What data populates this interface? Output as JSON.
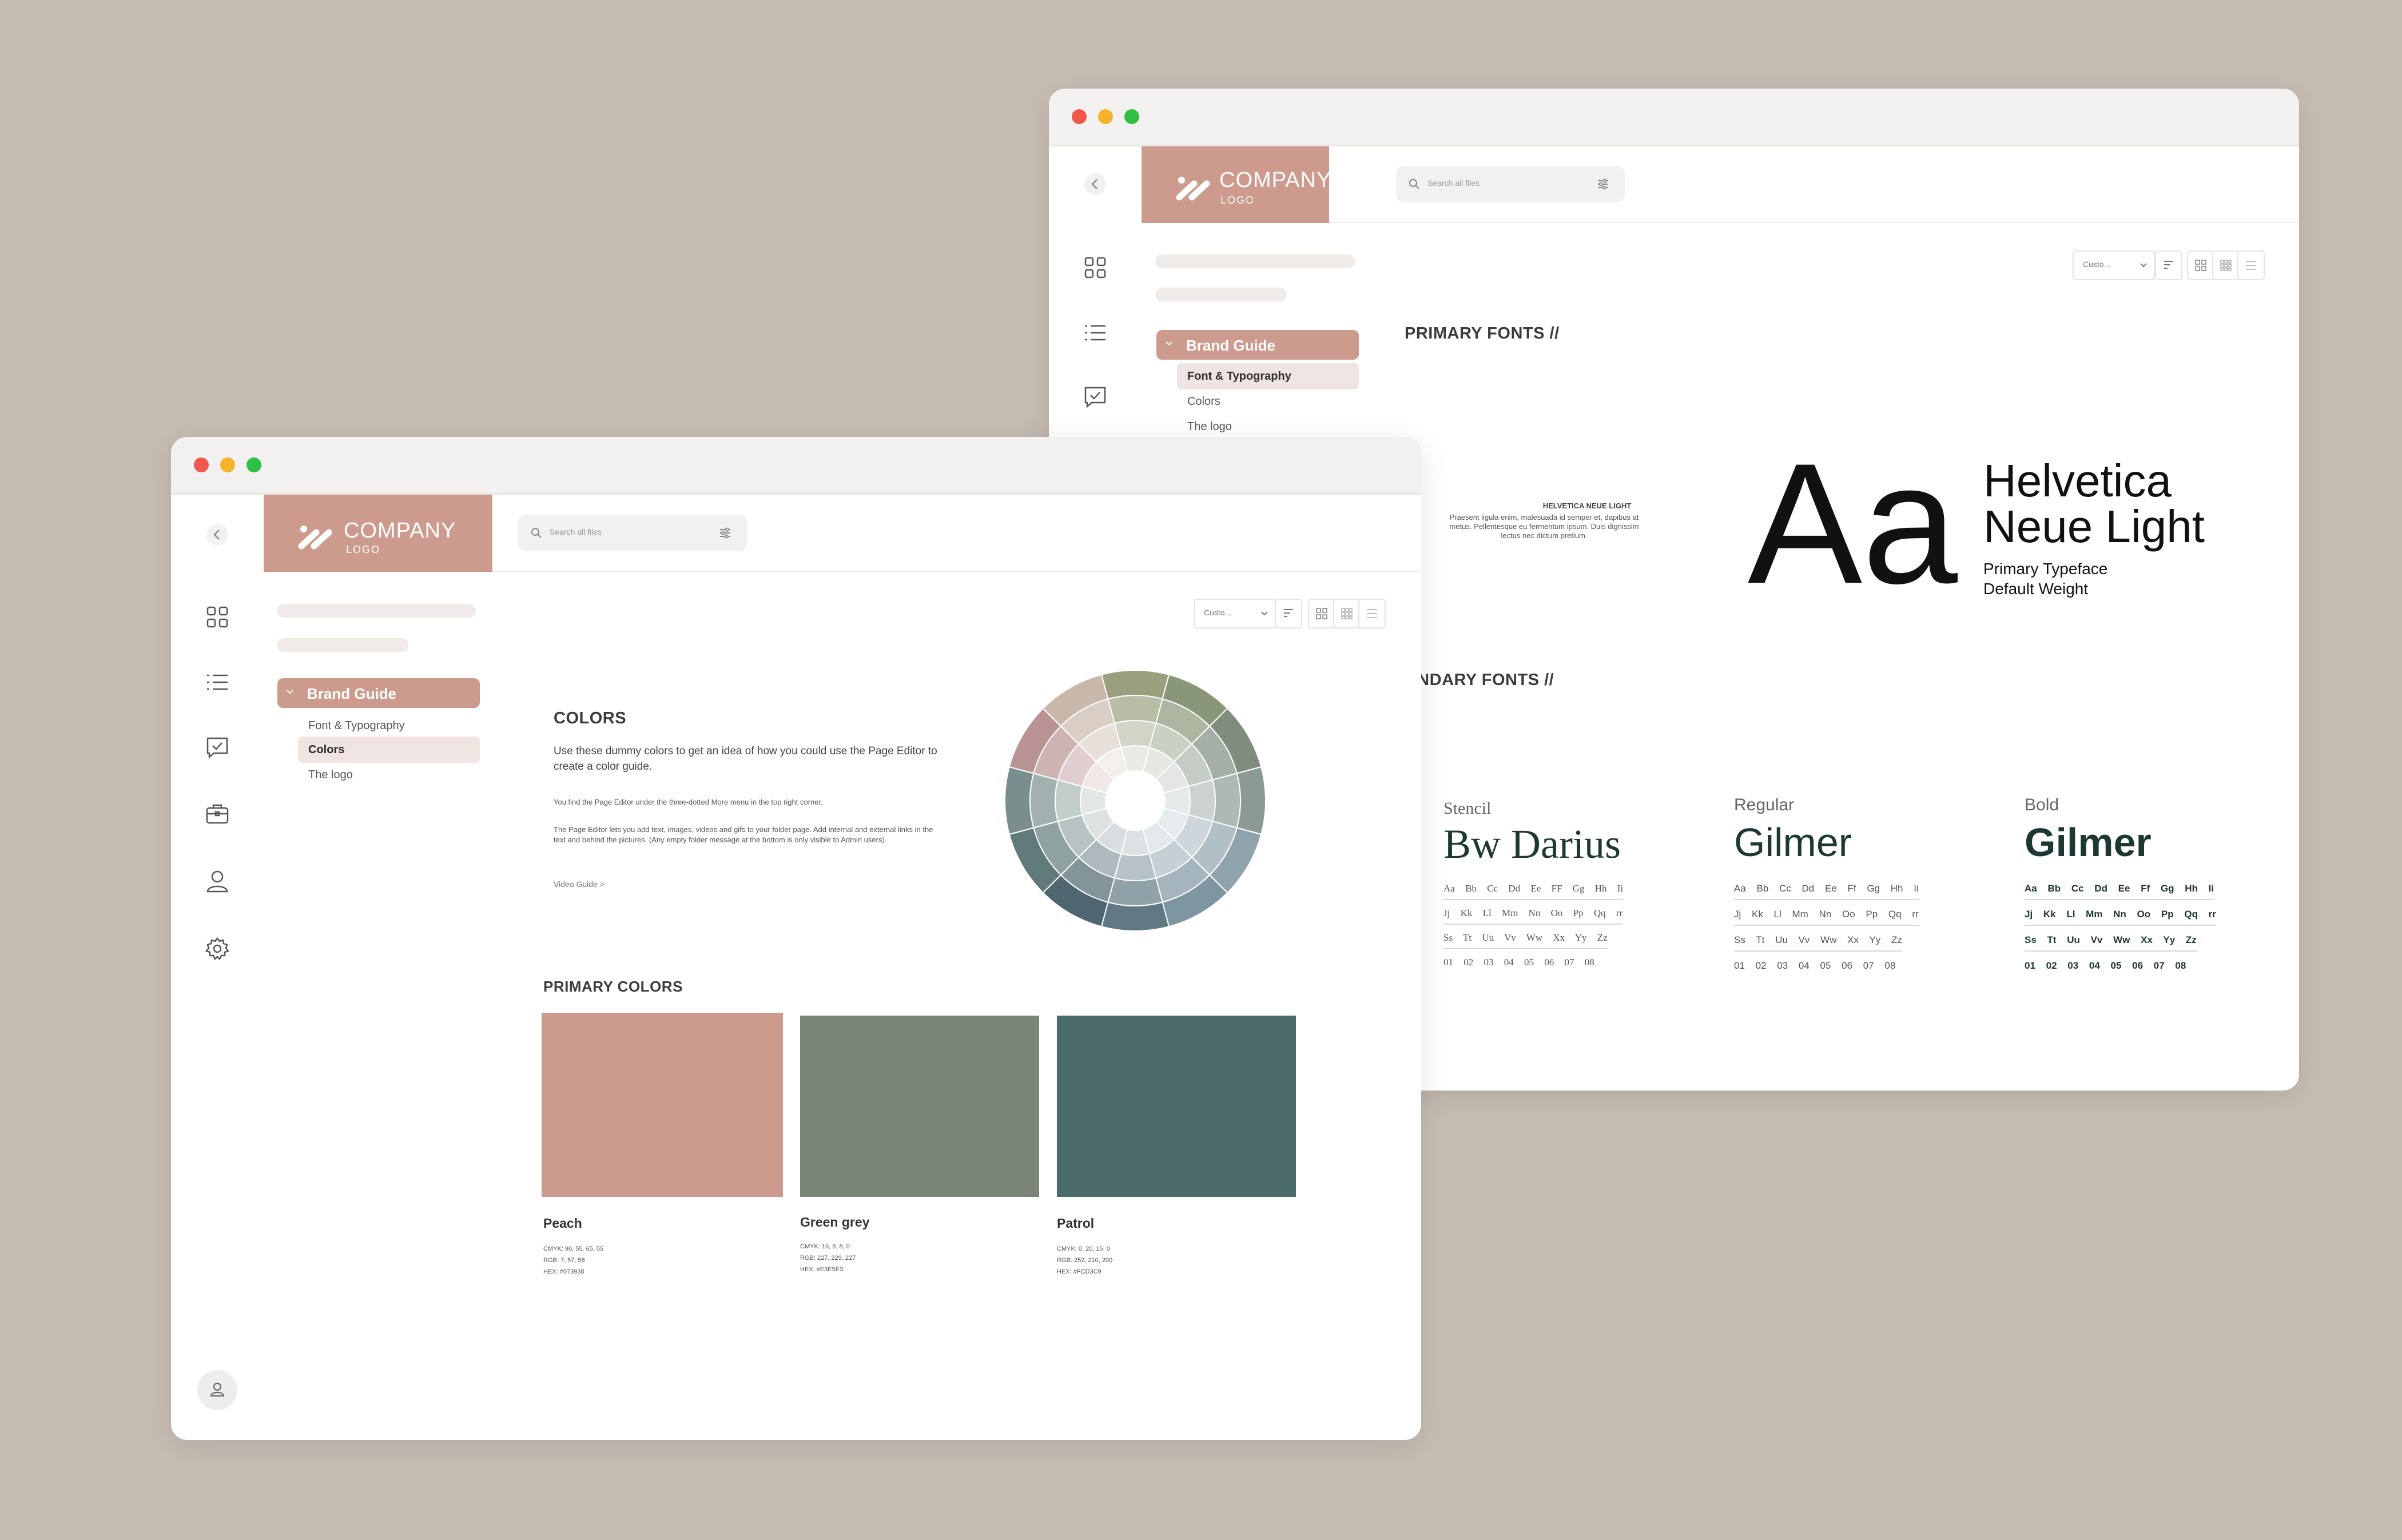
{
  "back_window": {
    "logo": {
      "title": "COMPANY",
      "subtitle": "LOGO"
    },
    "search": {
      "placeholder": "Search all files"
    },
    "toolbar": {
      "sort_select": "Custo..."
    },
    "nav": {
      "section_label": "Brand Guide",
      "items": [
        "Font & Typography",
        "Colors",
        "The logo"
      ],
      "active_index": 0
    },
    "primary_fonts": {
      "title": "PRIMARY FONTS //",
      "sample_heading": "HELVETICA NEUE LIGHT",
      "sample_text": "Praesent ligula enim, malesuada id semper et, dapibus at metus. Pellentesque eu fermentum ipsum. Duis dignissim lectus nec dictum pretium.",
      "specimen": "Aa",
      "font_name_line1": "Helvetica",
      "font_name_line2": "Neue Light",
      "caption_line1": "Primary Typeface",
      "caption_line2": "Default Weight"
    },
    "secondary_fonts": {
      "title": "SECONDARY FONTS //",
      "fonts": [
        {
          "label": "Stencil",
          "name": "Bw Darius",
          "rows": [
            "Aa Bb Cc Dd Ee FF Gg Hh Ii",
            "Jj Kk Ll Mm Nn Oo Pp Qq rr",
            "Ss Tt Uu Vv Ww Xx Yy Zz",
            "01 02 03 04 05 06 07 08"
          ]
        },
        {
          "label": "Regular",
          "name": "Gilmer",
          "rows": [
            "Aa Bb Cc Dd Ee Ff Gg Hh Ii",
            "Jj Kk Ll Mm Nn Oo Pp Qq rr",
            "Ss Tt Uu Vv Ww Xx Yy Zz",
            "01 02 03 04 05 06 07 08"
          ]
        },
        {
          "label": "Bold",
          "name": "Gilmer",
          "rows": [
            "Aa Bb Cc Dd Ee Ff Gg Hh Ii",
            "Jj Kk Ll Mm Nn Oo Pp Qq rr",
            "Ss Tt Uu Vv Ww Xx Yy Zz",
            "01 02 03 04 05 06 07 08"
          ]
        }
      ]
    }
  },
  "front_window": {
    "logo": {
      "title": "COMPANY",
      "subtitle": "LOGO"
    },
    "search": {
      "placeholder": "Search all files"
    },
    "toolbar": {
      "sort_select": "Custo..."
    },
    "nav": {
      "section_label": "Brand Guide",
      "items": [
        "Font & Typography",
        "Colors",
        "The logo"
      ],
      "active_index": 1
    },
    "colors_intro": {
      "title": "COLORS",
      "lead": "Use these dummy colors to get an idea of how you could use the Page Editor to create a color guide.",
      "note1": "You find the Page Editor under the three-dotted More menu in the top right corner.",
      "note2": "The Page Editor lets you add text, images, videos and gifs to your folder page. Add internal and external links in the text and behind the pictures. (Any empty folder message at the bottom is only visible to Admin users)",
      "link": "Video Guide >"
    },
    "primary_colors": {
      "title": "PRIMARY COLORS",
      "swatches": [
        {
          "name": "Peach",
          "color": "#cd9b8d",
          "cmyk": "CMYK: 90, 55, 65, 55",
          "rgb": "RGB: 7, 57, 56",
          "hex": "HEX: #073938"
        },
        {
          "name": "Green grey",
          "color": "#7b8478",
          "cmyk": "CMYK: 10, 6, 8, 0",
          "rgb": "RGB: 227, 229, 227",
          "hex": "HEX: #E3E5E3"
        },
        {
          "name": "Patrol",
          "color": "#4b6b6c",
          "cmyk": "CMYK: 0, 20, 15, 0",
          "rgb": "RGB: 252, 210, 200",
          "hex": "HEX: #FCD3C9"
        }
      ]
    }
  },
  "colors": {
    "background": "#c6bcb2",
    "accent": "#cd9b8d",
    "accent_light": "#f0e4e2",
    "dark_green": "#1d3732"
  }
}
